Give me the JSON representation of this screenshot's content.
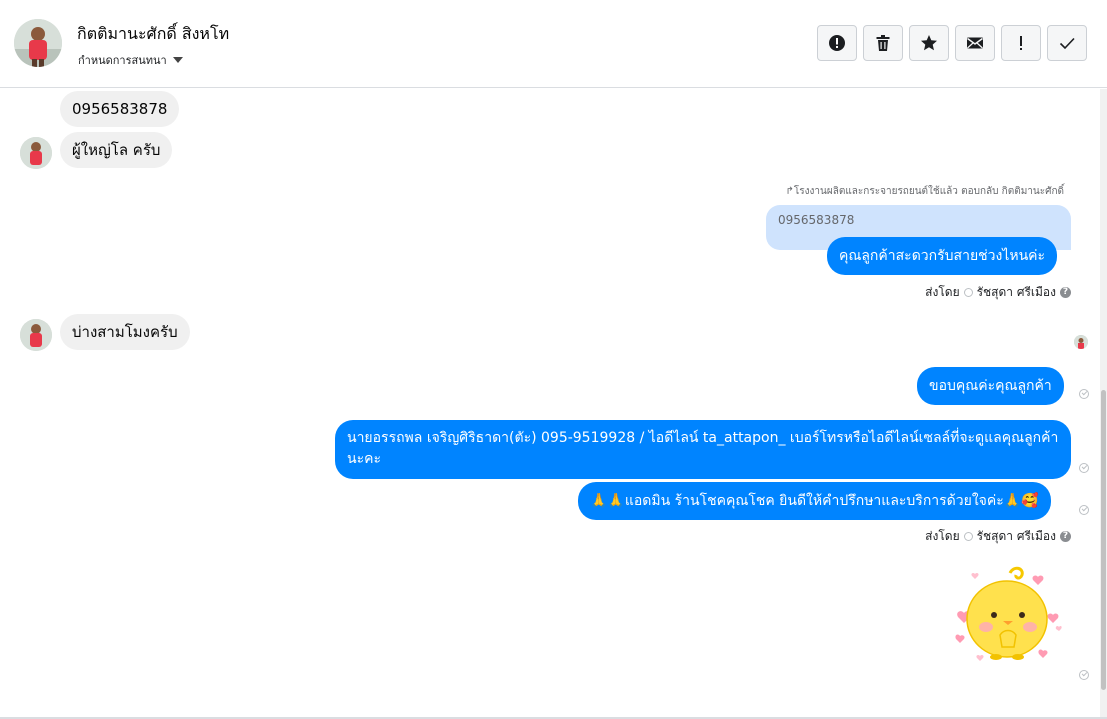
{
  "header": {
    "contact_name": "กิตติมานะศักดิ์ สิงหโท",
    "assign_label": "กำหนดการสนทนา",
    "toolbar": [
      {
        "name": "spam-button",
        "icon": "alert-circle-icon"
      },
      {
        "name": "delete-button",
        "icon": "trash-icon"
      },
      {
        "name": "star-button",
        "icon": "star-icon"
      },
      {
        "name": "mark-unread-button",
        "icon": "envelope-icon"
      },
      {
        "name": "follow-up-button",
        "icon": "exclamation-icon"
      },
      {
        "name": "mark-done-button",
        "icon": "check-icon"
      }
    ]
  },
  "messages": {
    "in_1": "0956583878",
    "in_2": "ผู้ใหญ่โล ครับ",
    "reply_meta": "โรงงานผลิตและกระจายรถยนต์ใช้แล้ว ตอบกลับ กิตติมานะศักดิ์",
    "quoted_text": "0956583878",
    "out_1": "คุณลูกค้าสะดวกรับสายช่วงไหนค่ะ",
    "sent_by_1_label": "ส่งโดย",
    "sent_by_1_name": "รัชสุดา ศรีเมือง",
    "in_3": "บ่างสามโมงครับ",
    "out_2": "ขอบคุณค่ะคุณลูกค้า",
    "out_3": "นายอรรถพล เจริญศิริธาดา(ตัะ)       095-9519928 / ไอดีไลน์ ta_attapon_  เบอร์โทรหรือไอดีไลน์เซลล์ที่จะดูแลคุณลูกค้านะคะ",
    "out_4": "🙏🙏แอดมิน ร้านโชคคุณโชค ยินดีให้คำปรึกษาและบริการด้วยใจค่ะ🙏🥰",
    "sent_by_2_label": "ส่งโดย",
    "sent_by_2_name": "รัชสุดา ศรีเมือง",
    "sticker": "chick-sticker"
  },
  "colors": {
    "outgoing": "#0084ff",
    "incoming": "#f0f0f0",
    "quoted": "#cfe3fd"
  }
}
